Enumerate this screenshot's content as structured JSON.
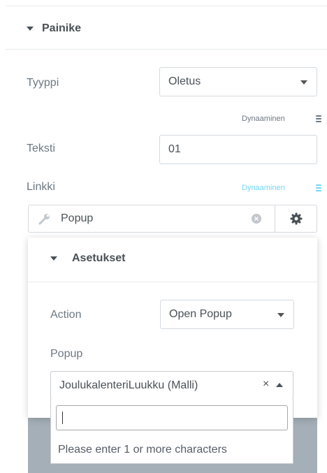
{
  "section": {
    "title": "Painike"
  },
  "fields": {
    "type": {
      "label": "Tyyppi",
      "value": "Oletus"
    },
    "type_dynamic": "Dynaaminen",
    "text": {
      "label": "Teksti",
      "value": "01"
    },
    "link": {
      "label": "Linkki",
      "dynamic": "Dynaaminen",
      "value": "Popup"
    }
  },
  "panel": {
    "title": "Asetukset",
    "action": {
      "label": "Action",
      "value": "Open Popup"
    },
    "popup": {
      "label": "Popup",
      "value": "JoulukalenteriLuukku (Malli)",
      "clear": "×",
      "search_hint": "Please enter 1 or more characters"
    }
  },
  "colors": {
    "accent": "#71d7f7",
    "heading": "#495157",
    "label": "#6d7882",
    "border": "#d5dadf",
    "overlay": "#a4afb7"
  },
  "icons": [
    "caret-down-icon",
    "database-icon",
    "wrench-icon",
    "clear-circle-icon",
    "gear-icon"
  ]
}
